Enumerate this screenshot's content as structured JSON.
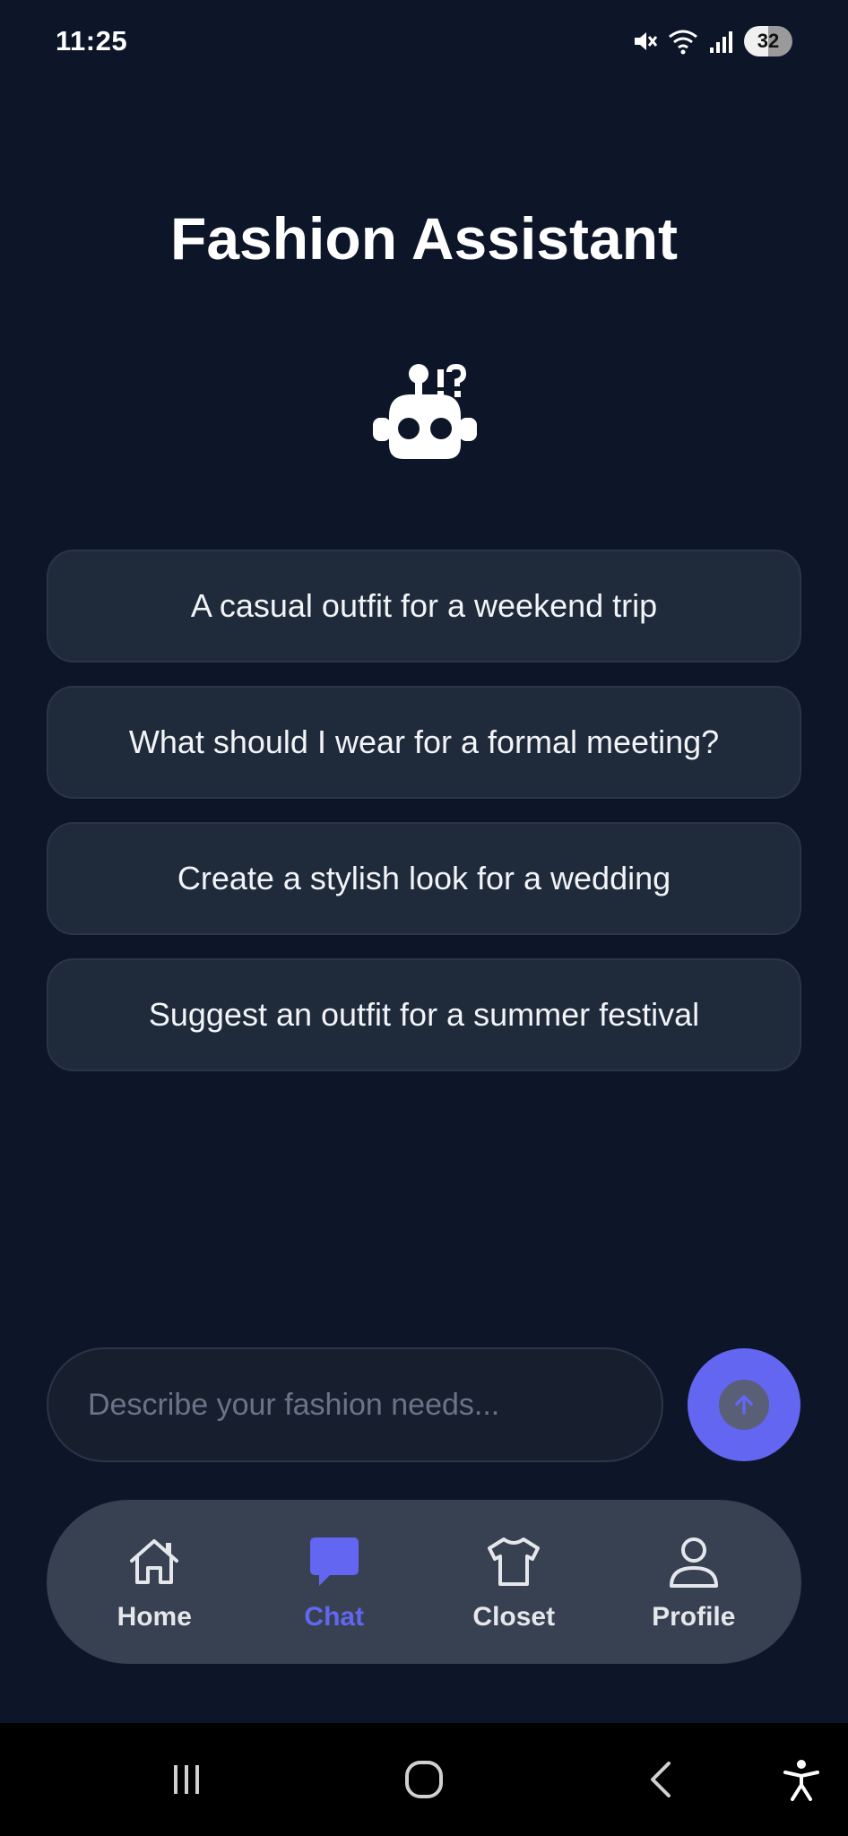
{
  "status_bar": {
    "time": "11:25",
    "battery": "32",
    "icons": [
      "mute-icon",
      "wifi-icon",
      "signal-icon",
      "battery-icon"
    ]
  },
  "header": {
    "title": "Fashion Assistant",
    "icon": "robot-icon"
  },
  "suggestions": [
    "A casual outfit for a weekend trip",
    "What should I wear for a formal meeting?",
    "Create a stylish look for a wedding",
    "Suggest an outfit for a summer festival"
  ],
  "input": {
    "placeholder": "Describe your fashion needs...",
    "value": ""
  },
  "send_button": {
    "icon": "arrow-up-icon"
  },
  "nav": {
    "items": [
      {
        "label": "Home",
        "icon": "home-icon",
        "active": false
      },
      {
        "label": "Chat",
        "icon": "chat-icon",
        "active": true
      },
      {
        "label": "Closet",
        "icon": "shirt-icon",
        "active": false
      },
      {
        "label": "Profile",
        "icon": "user-icon",
        "active": false
      }
    ]
  },
  "system_nav": [
    "recents-icon",
    "home-circle-icon",
    "back-icon",
    "accessibility-icon"
  ],
  "colors": {
    "background": "#0d1628",
    "card": "#1f2a3b",
    "accent": "#6366f1",
    "nav_bar": "#374151"
  }
}
